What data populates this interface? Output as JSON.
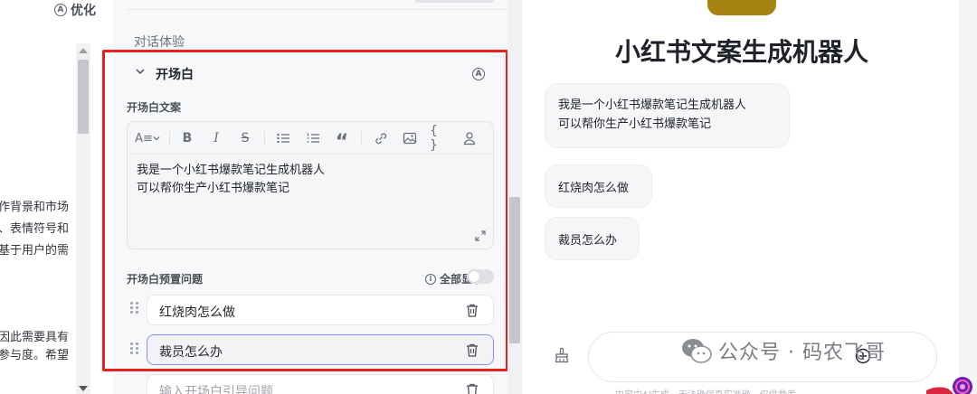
{
  "left_panel": {
    "optimize_label": "优化",
    "prompt_fragments": [
      "作背景和市场",
      "、表情符号和",
      "基于用户的需",
      "因此需要具有",
      "参与度。希望"
    ]
  },
  "config": {
    "section_title": "对话体验",
    "opening": {
      "title": "开场白",
      "copy_label": "开场白文案",
      "toolbar_text_style": "A≡",
      "editor_lines": [
        "我是一个小红书爆款笔记生成机器人",
        "可以帮你生产小红书爆款笔记"
      ],
      "preset_label": "开场白预置问题",
      "show_all_label": "全部显示",
      "show_all_on": false,
      "questions": [
        "红烧肉怎么做",
        "裁员怎么办"
      ],
      "new_question_placeholder": "输入开场白引导问题"
    }
  },
  "preview": {
    "bot_name": "小红书文案生成机器人",
    "opening_lines": [
      "我是一个小红书爆款笔记生成机器人",
      "可以帮你生产小红书爆款笔记"
    ],
    "suggested_questions": [
      "红烧肉怎么做",
      "裁员怎么办"
    ],
    "bottom_note": "内容由AI生成，无法确保真实准确，仅供参考"
  },
  "watermark": {
    "text": "公众号 · 码农飞哥"
  },
  "colors": {
    "highlight_frame": "#e8211e",
    "active_border": "#8c8ff0",
    "avatar": "#a58211"
  }
}
